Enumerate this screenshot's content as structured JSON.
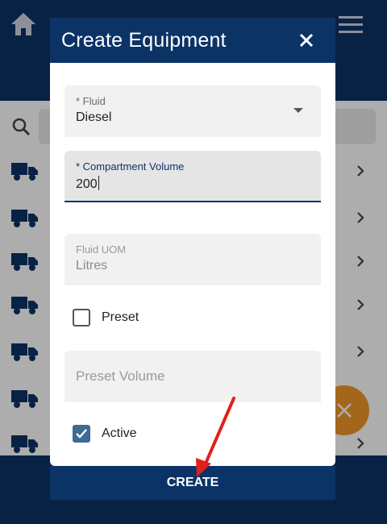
{
  "dialog": {
    "title": "Create Equipment",
    "fields": {
      "fluid": {
        "label": "* Fluid",
        "value": "Diesel"
      },
      "compartment_volume": {
        "label": "* Compartment Volume",
        "value": "200"
      },
      "fluid_uom": {
        "label": "Fluid UOM",
        "value": "Litres"
      },
      "preset_volume": {
        "placeholder": "Preset Volume"
      }
    },
    "checkboxes": {
      "preset": {
        "label": "Preset",
        "checked": false
      },
      "active": {
        "label": "Active",
        "checked": true
      }
    },
    "create_label": "CREATE"
  },
  "icons": {
    "home": "home-icon",
    "menu": "hamburger-menu-icon",
    "search": "search-icon",
    "truck": "truck-icon",
    "chevron": "chevron-right-icon",
    "close": "close-icon",
    "checkmark": "checkmark-icon",
    "fab": "close-icon"
  },
  "colors": {
    "primary": "#0c3366",
    "fab": "#f0982a",
    "checkbox_checked": "#3d6b94",
    "annotation_arrow": "#e0201a"
  }
}
